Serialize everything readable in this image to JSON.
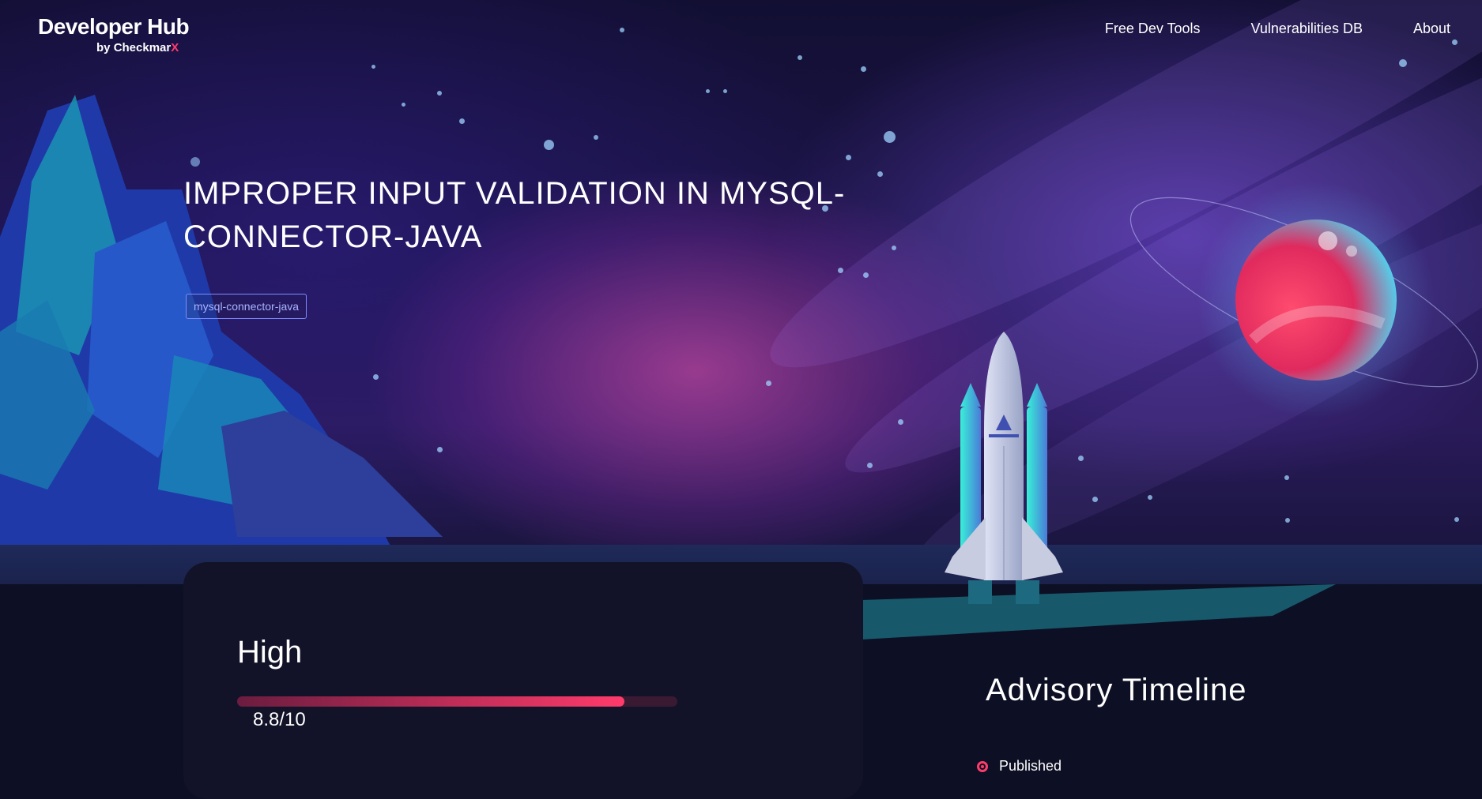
{
  "header": {
    "logo_title": "Developer Hub",
    "logo_by": "by",
    "logo_brand": "Checkmar",
    "logo_brand_x": "X",
    "nav": [
      "Free Dev Tools",
      "Vulnerabilities DB",
      "About"
    ]
  },
  "hero": {
    "title": "IMPROPER INPUT VALIDATION IN MYSQL-CONNECTOR-JAVA",
    "tag": "mysql-connector-java"
  },
  "severity": {
    "label": "High",
    "score": "8.8/10",
    "score_fraction": 0.88
  },
  "timeline": {
    "title": "Advisory Timeline",
    "items": [
      "Published"
    ]
  },
  "colors": {
    "accent": "#ff3b6b",
    "tag_border": "#7d8cff",
    "card_bg": "#121328"
  }
}
